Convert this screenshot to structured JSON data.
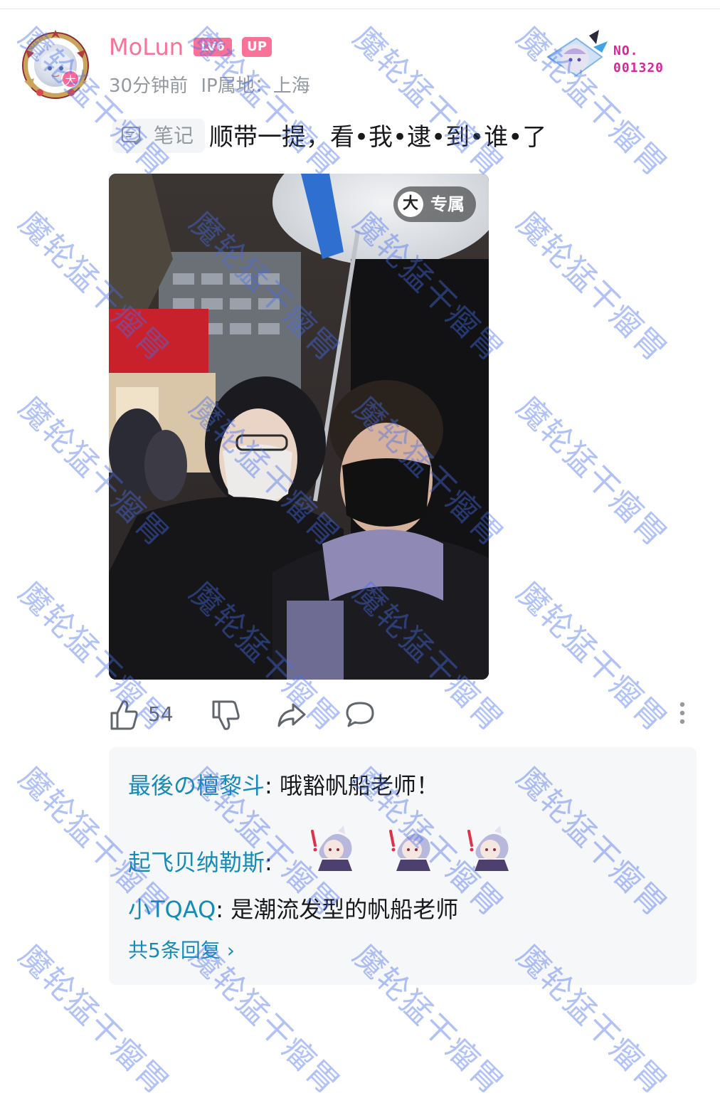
{
  "user": {
    "name": "MoLun",
    "level_badge": "LV6",
    "up_badge": "UP",
    "time": "30分钟前",
    "ip_location": "IP属地：上海",
    "avatar_badge": "大"
  },
  "decoration": {
    "number": "NO.\n001320"
  },
  "post": {
    "note_label": "笔记",
    "text": "顺带一提，看•我•逮•到•谁•了",
    "exclusive_label": "专属",
    "exclusive_icon": "大"
  },
  "actions": {
    "like_count": "54",
    "icons": [
      "thumbs-up-icon",
      "thumbs-down-icon",
      "share-icon",
      "comment-icon",
      "more-vertical-icon"
    ]
  },
  "comments": [
    {
      "author": "最後の檀黎斗",
      "sep": ":",
      "text": " 哦豁帆船老师！"
    },
    {
      "author": "起飞贝纳勒斯",
      "sep": ":",
      "text": ""
    },
    {
      "author": "小TQAQ",
      "sep": ":",
      "text": " 是潮流发型的帆船老师"
    }
  ],
  "replies_link": "共5条回复 ›",
  "watermark": "魔轮猛干瘤胃",
  "colors": {
    "brand_pink": "#fb7299",
    "link_blue": "#178bb7",
    "text_gray": "#9499a0",
    "watermark_blue": "#466eeb"
  }
}
